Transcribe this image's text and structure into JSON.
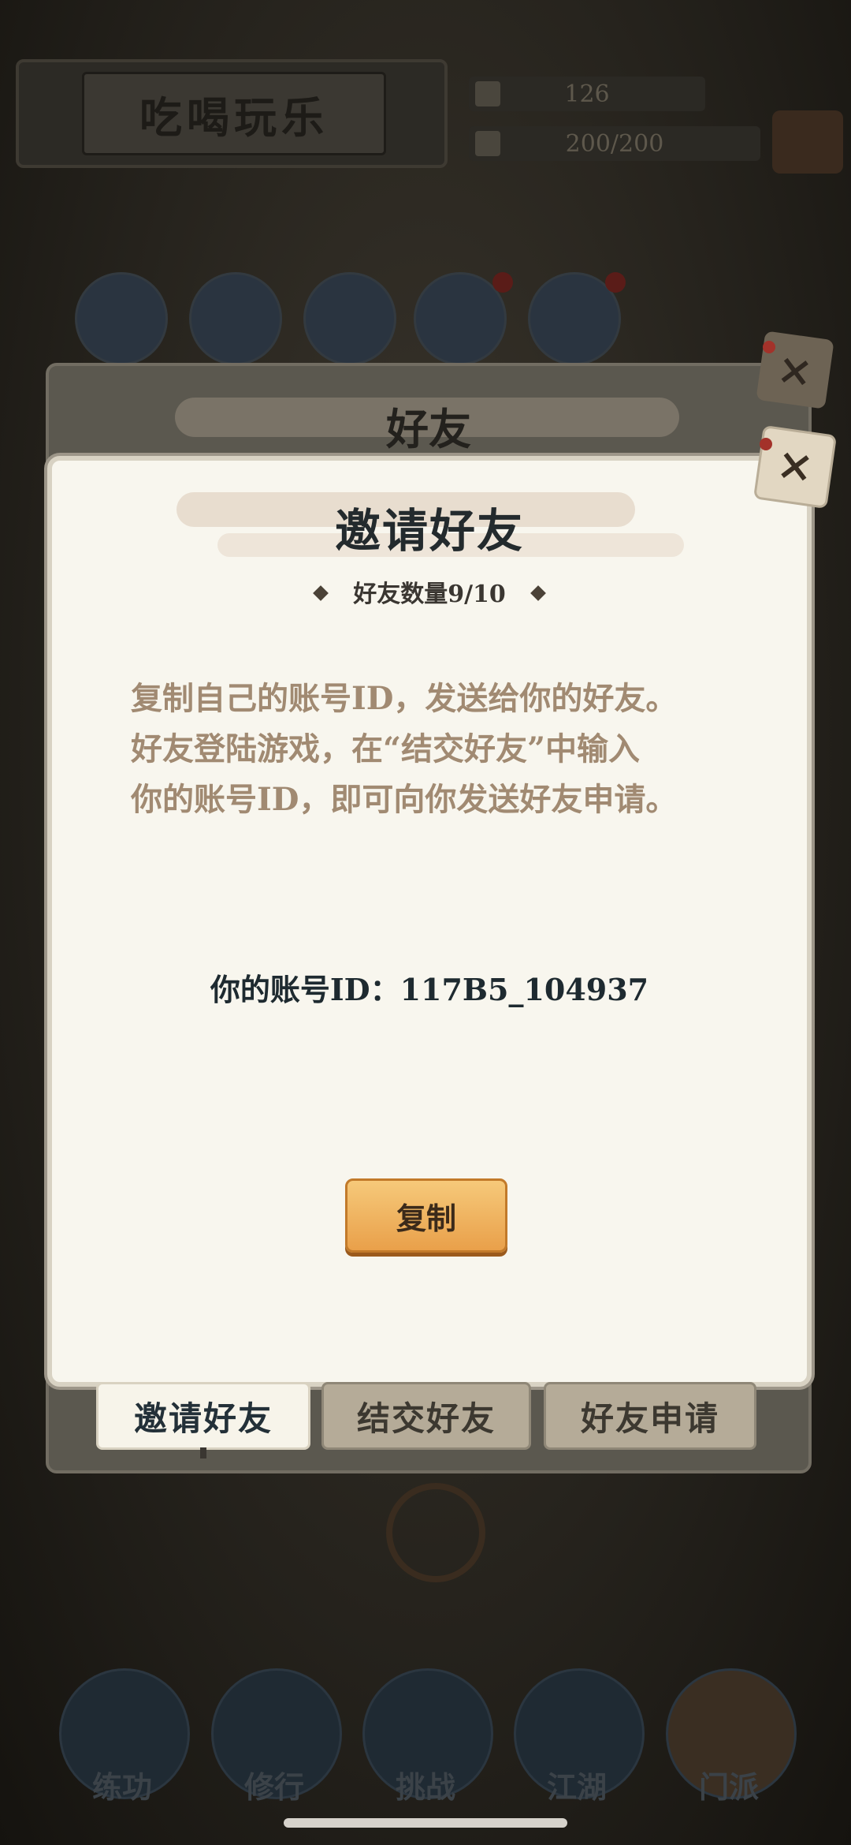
{
  "game": {
    "title": "吃喝玩乐",
    "resource_currency": "126",
    "resource_energy": "200/200"
  },
  "back_panel": {
    "title": "好友"
  },
  "dialog": {
    "title": "邀请好友",
    "friend_count": "好友数量9/10",
    "description_lines": [
      "复制自己的账号ID，发送给你的好友。",
      "好友登陆游戏，在“结交好友”中输入",
      "你的账号ID，即可向你发送好友申请。"
    ],
    "account_label": "你的账号ID：117B5_104937",
    "copy_button": "复制",
    "close_icon": "×"
  },
  "tabs": [
    {
      "label": "邀请好友",
      "active": true
    },
    {
      "label": "结交好友",
      "active": false
    },
    {
      "label": "好友申请",
      "active": false
    }
  ],
  "bottom_nav": [
    {
      "label": "练功"
    },
    {
      "label": "修行"
    },
    {
      "label": "挑战"
    },
    {
      "label": "江湖"
    },
    {
      "label": "门派"
    }
  ]
}
